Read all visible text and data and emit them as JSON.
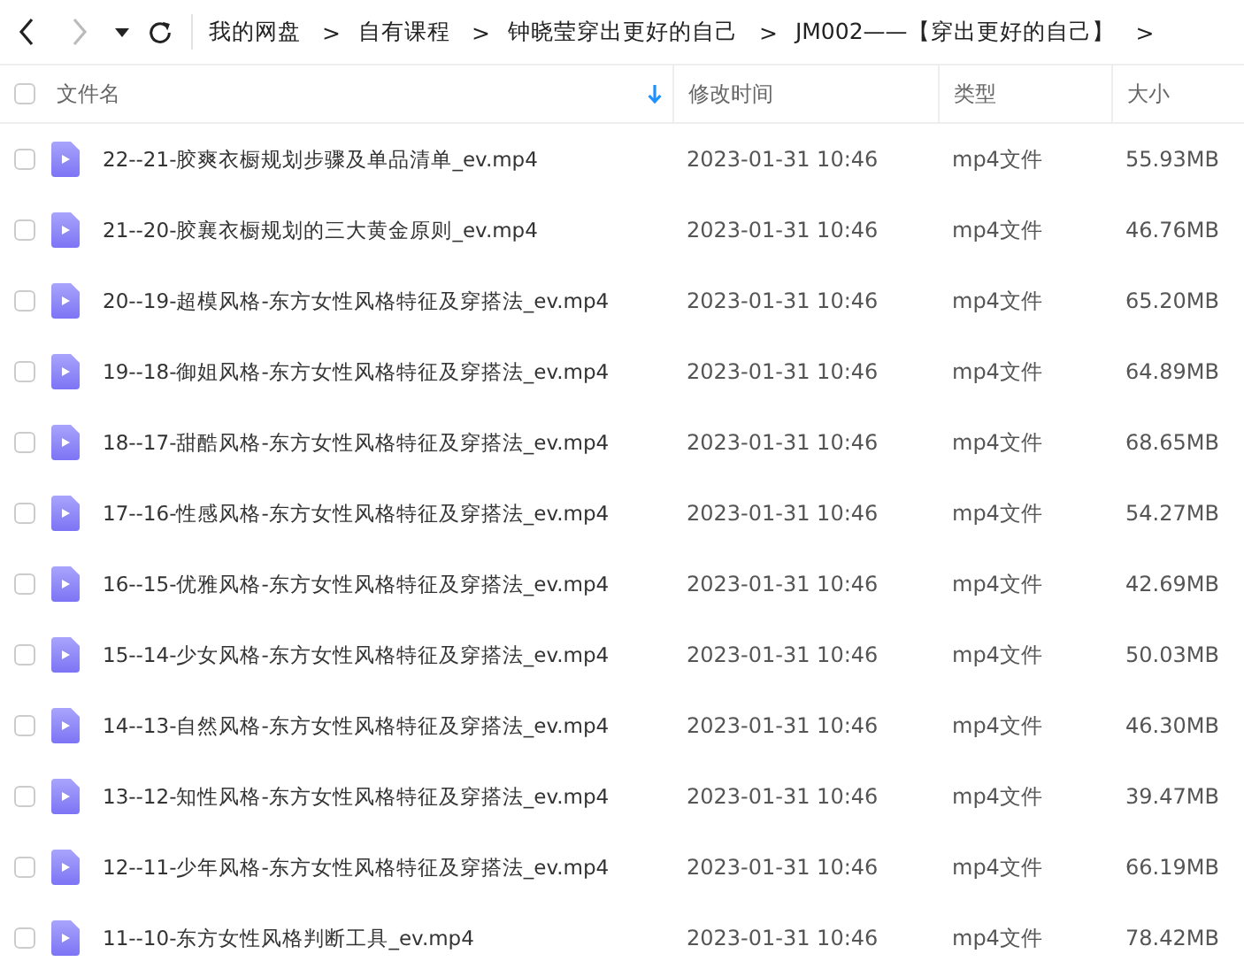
{
  "toolbar": {
    "back": {
      "disabled": false
    },
    "forward": {
      "disabled": true
    },
    "breadcrumbs": [
      "我的网盘",
      "自有课程",
      "钟晓莹穿出更好的自己",
      "JM002——【穿出更好的自己】"
    ],
    "separator": ">"
  },
  "table": {
    "select_all": {
      "checked": false
    },
    "columns": [
      {
        "label": "文件名",
        "sorted": true
      },
      {
        "label": "修改时间",
        "sorted": false
      },
      {
        "label": "类型",
        "sorted": false
      },
      {
        "label": "大小",
        "sorted": false
      }
    ],
    "rows": [
      {
        "checked": false,
        "name": "22--21-胶爽衣橱规划步骤及单品清单_ev.mp4",
        "modified": "2023-01-31 10:46",
        "type": "mp4文件",
        "size": "55.93MB"
      },
      {
        "checked": false,
        "name": "21--20-胶襄衣橱规划的三大黄金原则_ev.mp4",
        "modified": "2023-01-31 10:46",
        "type": "mp4文件",
        "size": "46.76MB"
      },
      {
        "checked": false,
        "name": "20--19-超模风格-东方女性风格特征及穿搭法_ev.mp4",
        "modified": "2023-01-31 10:46",
        "type": "mp4文件",
        "size": "65.20MB"
      },
      {
        "checked": false,
        "name": "19--18-御姐风格-东方女性风格特征及穿搭法_ev.mp4",
        "modified": "2023-01-31 10:46",
        "type": "mp4文件",
        "size": "64.89MB"
      },
      {
        "checked": false,
        "name": "18--17-甜酷风格-东方女性风格特征及穿搭法_ev.mp4",
        "modified": "2023-01-31 10:46",
        "type": "mp4文件",
        "size": "68.65MB"
      },
      {
        "checked": false,
        "name": "17--16-性感风格-东方女性风格特征及穿搭法_ev.mp4",
        "modified": "2023-01-31 10:46",
        "type": "mp4文件",
        "size": "54.27MB"
      },
      {
        "checked": false,
        "name": "16--15-优雅风格-东方女性风格特征及穿搭法_ev.mp4",
        "modified": "2023-01-31 10:46",
        "type": "mp4文件",
        "size": "42.69MB"
      },
      {
        "checked": false,
        "name": "15--14-少女风格-东方女性风格特征及穿搭法_ev.mp4",
        "modified": "2023-01-31 10:46",
        "type": "mp4文件",
        "size": "50.03MB"
      },
      {
        "checked": false,
        "name": "14--13-自然风格-东方女性风格特征及穿搭法_ev.mp4",
        "modified": "2023-01-31 10:46",
        "type": "mp4文件",
        "size": "46.30MB"
      },
      {
        "checked": false,
        "name": "13--12-知性风格-东方女性风格特征及穿搭法_ev.mp4",
        "modified": "2023-01-31 10:46",
        "type": "mp4文件",
        "size": "39.47MB"
      },
      {
        "checked": false,
        "name": "12--11-少年风格-东方女性风格特征及穿搭法_ev.mp4",
        "modified": "2023-01-31 10:46",
        "type": "mp4文件",
        "size": "66.19MB"
      },
      {
        "checked": false,
        "name": "11--10-东方女性风格判断工具_ev.mp4",
        "modified": "2023-01-31 10:46",
        "type": "mp4文件",
        "size": "78.42MB"
      }
    ]
  }
}
